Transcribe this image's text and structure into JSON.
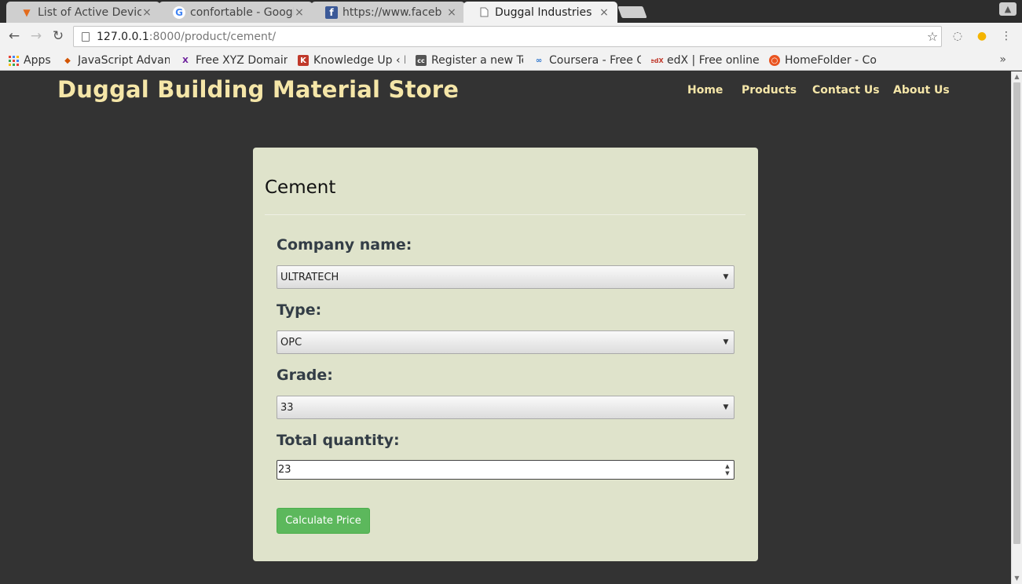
{
  "browser": {
    "tabs": [
      {
        "title": "List of Active Devic",
        "favicon": "shield-icon",
        "active": false
      },
      {
        "title": "confortable - Googl",
        "favicon": "google-icon",
        "active": false
      },
      {
        "title": "https://www.faceb",
        "favicon": "facebook-icon",
        "active": false
      },
      {
        "title": "Duggal Industries",
        "favicon": "page-icon",
        "active": true
      }
    ],
    "tab_close_glyph": "×",
    "url_host": "127.0.0.1",
    "url_rest": ":8000/product/cement/",
    "bookmarks": [
      {
        "label": "Apps",
        "icon": "apps-grid-icon"
      },
      {
        "label": "JavaScript Advan",
        "icon": "fox-icon"
      },
      {
        "label": "Free XYZ Domain",
        "icon": "xyz-icon"
      },
      {
        "label": "Knowledge Up ‹ L",
        "icon": "knowledge-icon"
      },
      {
        "label": "Register a new Te",
        "icon": "cc-icon"
      },
      {
        "label": "Coursera - Free O",
        "icon": "coursera-icon"
      },
      {
        "label": "edX | Free online",
        "icon": "edx-icon"
      },
      {
        "label": "HomeFolder - Co",
        "icon": "ubuntu-icon"
      }
    ],
    "bookmarks_more": "»"
  },
  "site": {
    "brand": "Duggal Building Material Store",
    "nav": [
      "Home",
      "Products",
      "Contact Us",
      "About Us"
    ]
  },
  "product": {
    "title": "Cement",
    "fields": {
      "company_label": "Company name:",
      "company_value": "ULTRATECH",
      "type_label": "Type:",
      "type_value": "OPC",
      "grade_label": "Grade:",
      "grade_value": "33",
      "quantity_label": "Total quantity:",
      "quantity_value": "23"
    },
    "submit_label": "Calculate Price"
  },
  "colors": {
    "page_bg": "#333333",
    "brand_text": "#f5e6a8",
    "card_bg": "#dfe3cb",
    "button_bg": "#5cb85c"
  }
}
